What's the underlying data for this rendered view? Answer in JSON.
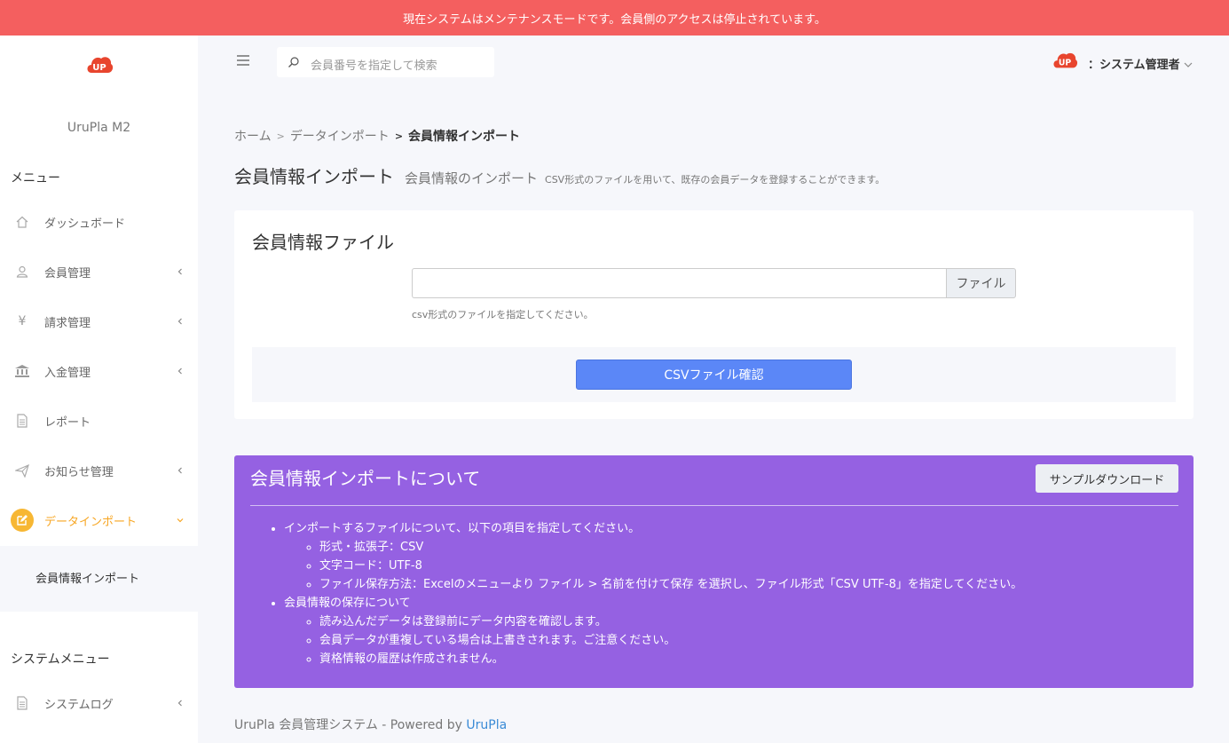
{
  "banner": {
    "text": "現在システムはメンテナンスモードです。会員側のアクセスは停止されています。"
  },
  "sidebar": {
    "brand": "UruPla M2",
    "menu_title": "メニュー",
    "items": [
      {
        "label": "ダッシュボード",
        "icon": "home-icon",
        "has_chevron": false
      },
      {
        "label": "会員管理",
        "icon": "user-icon",
        "has_chevron": true
      },
      {
        "label": "請求管理",
        "icon": "yen-icon",
        "has_chevron": true
      },
      {
        "label": "入金管理",
        "icon": "bank-icon",
        "has_chevron": true
      },
      {
        "label": "レポート",
        "icon": "document-icon",
        "has_chevron": false
      },
      {
        "label": "お知らせ管理",
        "icon": "send-icon",
        "has_chevron": true
      },
      {
        "label": "データインポート",
        "icon": "edit-icon",
        "has_chevron": true,
        "active": true
      }
    ],
    "sub_item": "会員情報インポート",
    "system_title": "システムメニュー",
    "system_items": [
      {
        "label": "システムログ",
        "icon": "document-icon",
        "has_chevron": true
      }
    ]
  },
  "topbar": {
    "search_placeholder": "会員番号を指定して検索",
    "user_name": "：システム管理者"
  },
  "breadcrumb": {
    "home": "ホーム",
    "sep": ">",
    "middle": "データインポート",
    "sep2": ">",
    "current": "会員情報インポート"
  },
  "page": {
    "title": "会員情報インポート",
    "subtitle": "会員情報のインポート",
    "description": "CSV形式のファイルを用いて、既存の会員データを登録することができます。"
  },
  "file_card": {
    "title": "会員情報ファイル",
    "file_button": "ファイル",
    "help": "csv形式のファイルを指定してください。",
    "submit": "CSVファイル確認"
  },
  "info": {
    "title": "会員情報インポートについて",
    "sample_button": "サンプルダウンロード",
    "sections": [
      {
        "heading": "インポートするファイルについて、以下の項目を指定してください。",
        "items": [
          "形式・拡張子：CSV",
          "文字コード：UTF-8",
          "ファイル保存方法：Excelのメニューより ファイル > 名前を付けて保存 を選択し、ファイル形式「CSV UTF-8」を指定してください。"
        ]
      },
      {
        "heading": "会員情報の保存について",
        "items": [
          "読み込んだデータは登録前にデータ内容を確認します。",
          "会員データが重複している場合は上書きされます。ご注意ください。",
          "資格情報の履歴は作成されません。"
        ]
      }
    ]
  },
  "footer": {
    "text": "UruPla 会員管理システム - Powered by ",
    "link": "UruPla"
  },
  "colors": {
    "banner": "#f45f5f",
    "active": "#f7a623",
    "primary_button": "#5b87f7",
    "info_panel": "#9561e2",
    "logo": "#e8452e"
  }
}
